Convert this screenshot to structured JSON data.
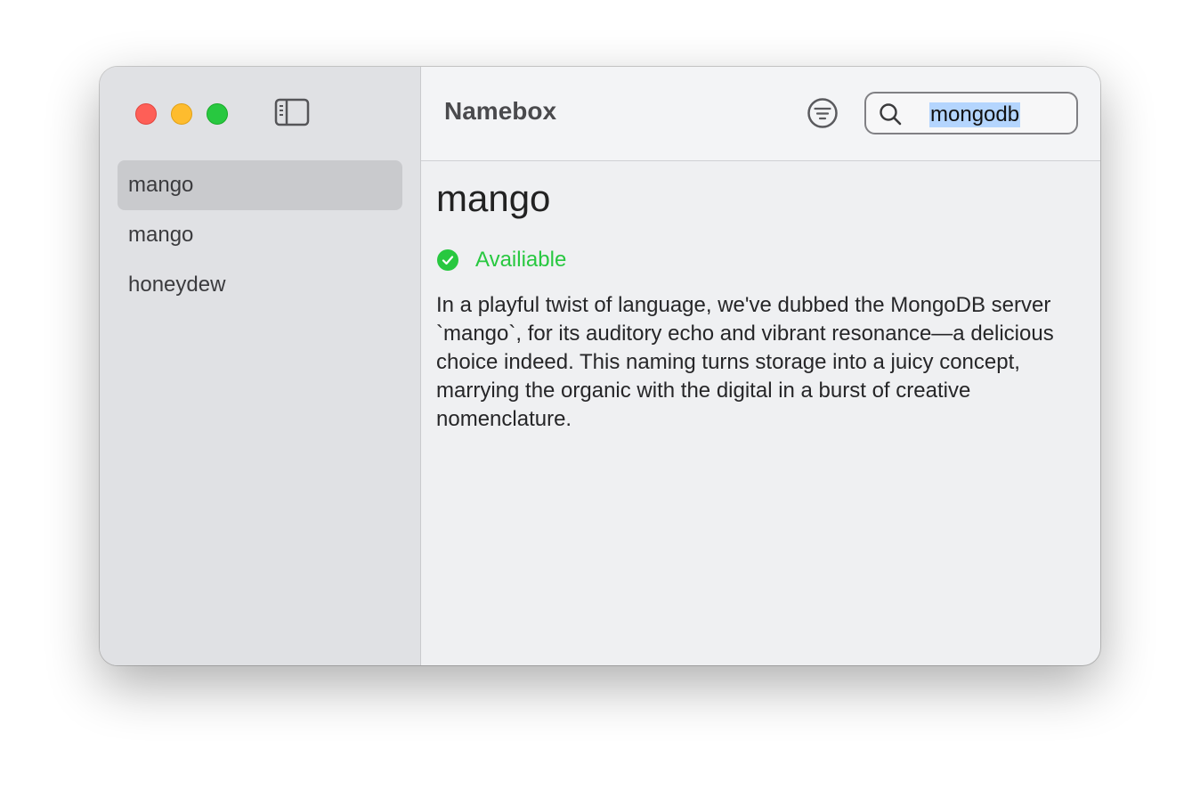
{
  "window": {
    "traffic_lights": {
      "close_color": "#fe5f57",
      "minimize_color": "#febc2e",
      "maximize_color": "#28c840"
    }
  },
  "sidebar": {
    "toggle_icon": "sidebar-left-icon",
    "items": [
      {
        "label": "mango",
        "selected": true
      },
      {
        "label": "mango",
        "selected": false
      },
      {
        "label": "honeydew",
        "selected": false
      }
    ]
  },
  "toolbar": {
    "title": "Namebox",
    "filter_icon": "filter-circle-icon",
    "search": {
      "icon": "search-icon",
      "value": "mongodb"
    }
  },
  "detail": {
    "title": "mango",
    "status": {
      "icon": "checkmark-circle-icon",
      "label": "Availiable",
      "color": "#28c840"
    },
    "description": "In a playful twist of language, we've dubbed the MongoDB server `mango`, for its auditory echo and vibrant resonance—a delicious choice indeed. This naming turns storage into a juicy concept, marrying the organic with the digital in a burst of creative nomenclature."
  }
}
